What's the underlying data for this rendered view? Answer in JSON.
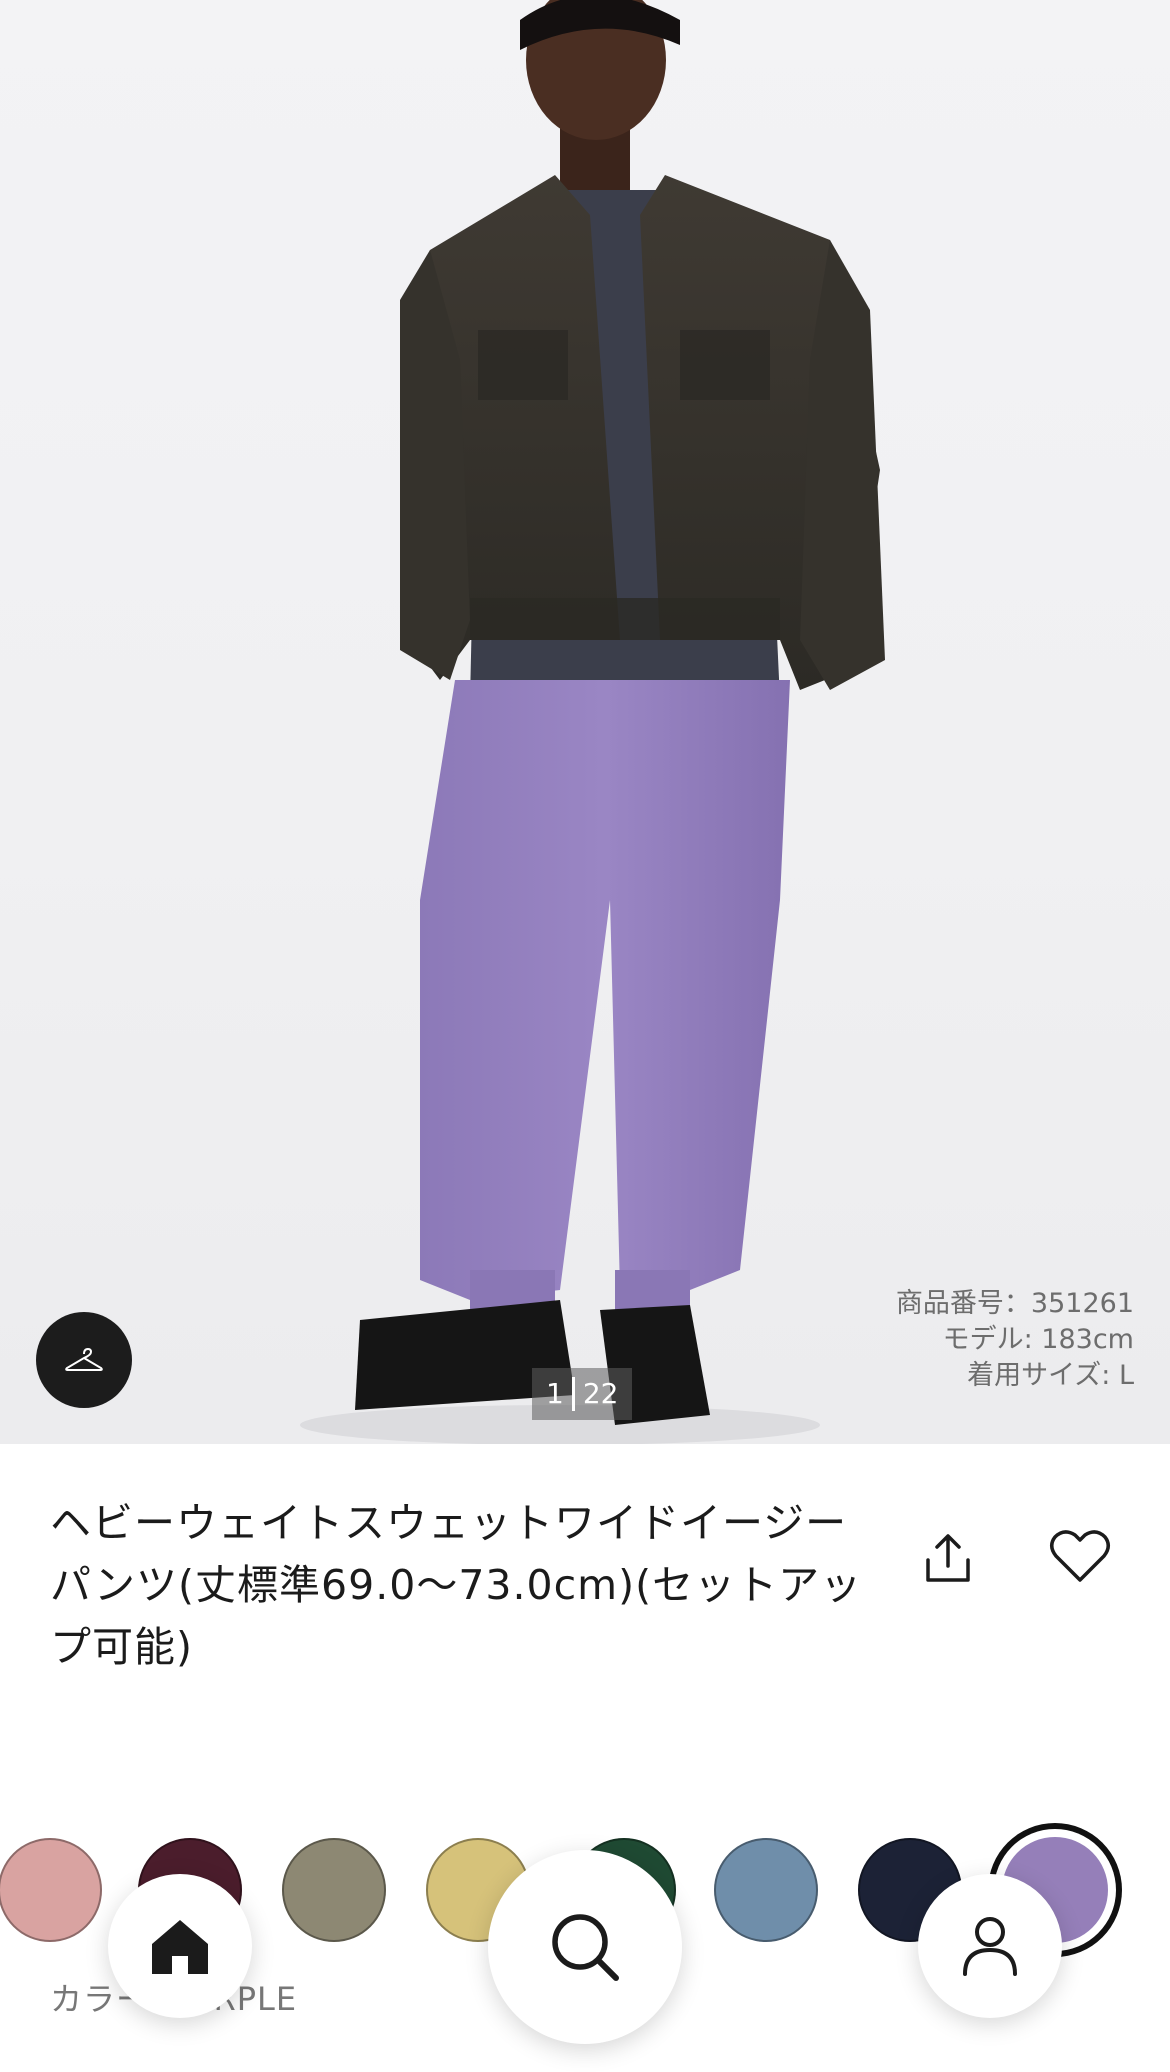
{
  "hero": {
    "meta": {
      "product_number": "商品番号：351261",
      "model_height": "モデル: 183cm",
      "wear_size": "着用サイズ: L"
    },
    "counter": {
      "current": "1",
      "total": "22"
    },
    "hanger_icon": "hanger-icon"
  },
  "product": {
    "title": "ヘビーウェイトスウェットワイドイージーパンツ(丈標準69.0〜73.0cm)(セットアップ可能)",
    "share_icon": "share-icon",
    "favorite_icon": "heart-icon"
  },
  "colors": {
    "swatches": [
      {
        "name": "pink",
        "hex": "#d9a3a1"
      },
      {
        "name": "wine",
        "hex": "#4b1d2c"
      },
      {
        "name": "olive",
        "hex": "#8d8873"
      },
      {
        "name": "yellow",
        "hex": "#d6c27a"
      },
      {
        "name": "green",
        "hex": "#1f4a33"
      },
      {
        "name": "blue",
        "hex": "#6f8eaa"
      },
      {
        "name": "navy",
        "hex": "#1c2236"
      },
      {
        "name": "purple",
        "hex": "#957fb9",
        "selected": true
      }
    ],
    "label_prefix": "カラー",
    "label_separator": ":",
    "selected_name": "PURPLE"
  },
  "nav": {
    "home_icon": "home-icon",
    "search_icon": "search-icon",
    "user_icon": "user-icon"
  }
}
